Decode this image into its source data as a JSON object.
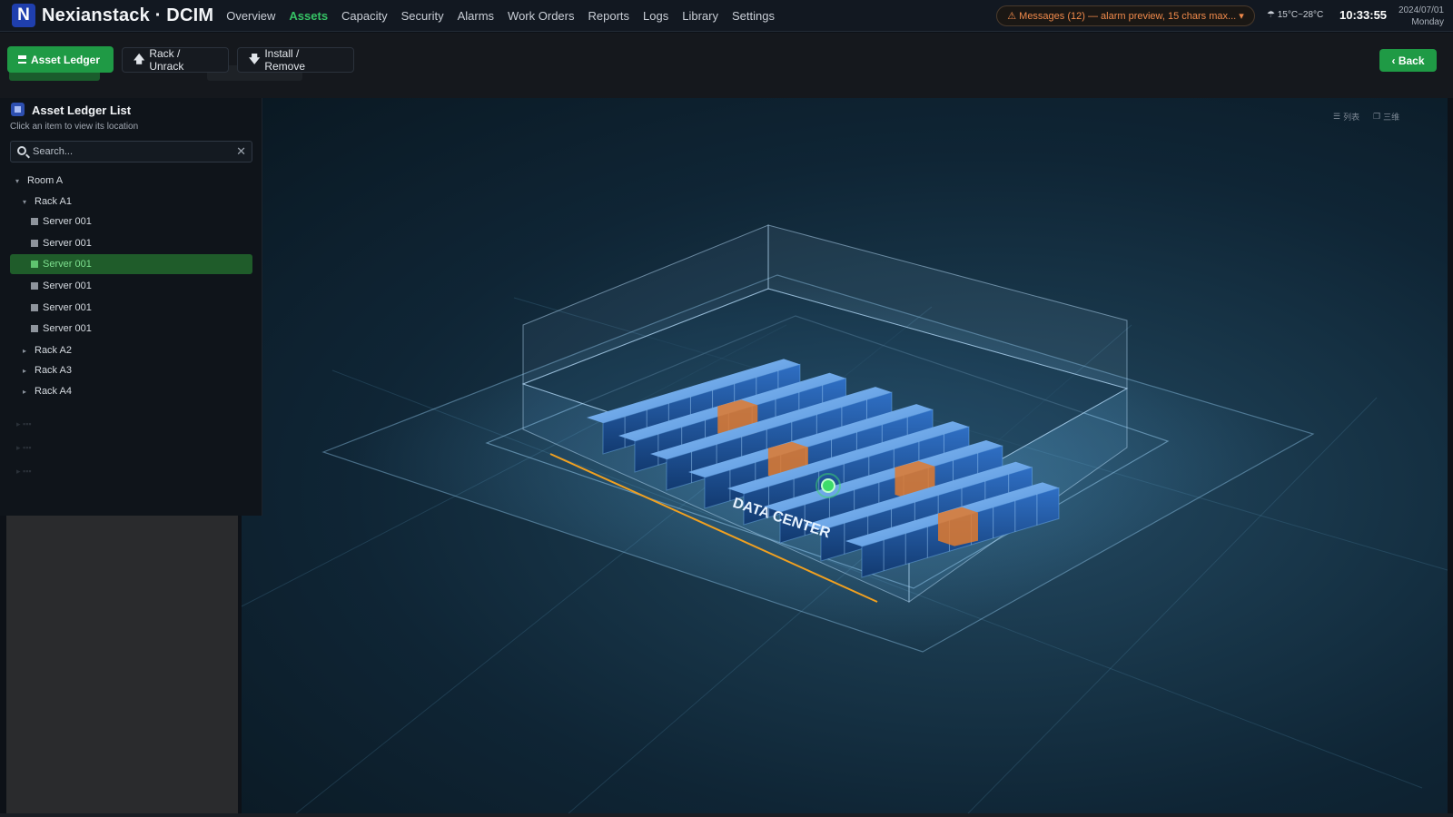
{
  "header": {
    "logo_letter": "N",
    "brand": "Nexianstack · DCIM",
    "nav": [
      {
        "label": "Overview",
        "active": false
      },
      {
        "label": "Assets",
        "active": true
      },
      {
        "label": "Capacity",
        "active": false
      },
      {
        "label": "Security",
        "active": false
      },
      {
        "label": "Alarms",
        "active": false
      },
      {
        "label": "Work Orders",
        "active": false
      },
      {
        "label": "Reports",
        "active": false
      },
      {
        "label": "Logs",
        "active": false
      },
      {
        "label": "Library",
        "active": false
      },
      {
        "label": "Settings",
        "active": false
      }
    ],
    "messages": "⚠ Messages (12) — alarm preview, 15 chars max... ▾",
    "weather": "☂ 15°C~28°C",
    "time": "10:33:55",
    "date": "2024/07/01",
    "weekday": "Monday"
  },
  "toolbar": {
    "tabs": [
      {
        "label": "Asset Ledger",
        "icon": "list-icon",
        "active": true
      },
      {
        "label": "Rack / Unrack",
        "icon": "upload-arrow-icon",
        "active": false
      },
      {
        "label": "Install / Remove",
        "icon": "download-arrow-icon",
        "active": false
      }
    ],
    "back_label": "‹ Back"
  },
  "panel": {
    "title": "Asset Ledger List",
    "subtitle": "Click an item to view its location",
    "search_placeholder": "Search...",
    "tree": [
      {
        "label": "Room A",
        "level": 0,
        "expanded": true,
        "type": "room"
      },
      {
        "label": "Rack A1",
        "level": 1,
        "expanded": true,
        "type": "rack"
      },
      {
        "label": "Server 001",
        "level": 2,
        "type": "server",
        "selected": false
      },
      {
        "label": "Server 001",
        "level": 2,
        "type": "server",
        "selected": false
      },
      {
        "label": "Server 001",
        "level": 2,
        "type": "server",
        "selected": true
      },
      {
        "label": "Server 001",
        "level": 2,
        "type": "server",
        "selected": false
      },
      {
        "label": "Server 001",
        "level": 2,
        "type": "server",
        "selected": false
      },
      {
        "label": "Server 001",
        "level": 2,
        "type": "server",
        "selected": false
      },
      {
        "label": "Rack A2",
        "level": 1,
        "expanded": false,
        "type": "rack"
      },
      {
        "label": "Rack A3",
        "level": 1,
        "expanded": false,
        "type": "rack"
      },
      {
        "label": "Rack A4",
        "level": 1,
        "expanded": false,
        "type": "rack"
      }
    ]
  },
  "viewport": {
    "toggle_list": "列表",
    "toggle_3d": "三维",
    "floor_label": "DATA CENTER"
  },
  "colors": {
    "accent_green": "#1f9a45",
    "nav_active": "#36c265",
    "alarm_orange": "#f08a4b",
    "rack_blue": "#3a8fe0",
    "rack_orange": "#e07a2e",
    "marker_green": "#3ddc6a"
  }
}
